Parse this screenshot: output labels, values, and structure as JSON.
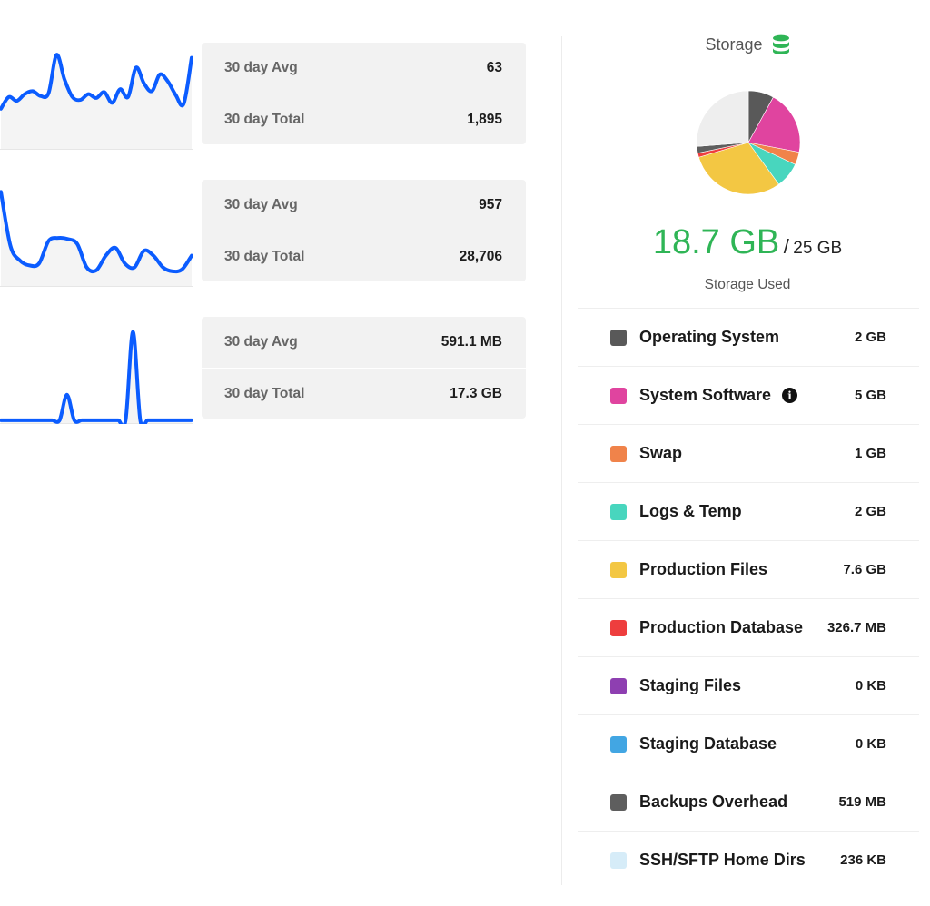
{
  "metrics": [
    {
      "sparkline": [
        40,
        52,
        48,
        55,
        58,
        53,
        56,
        95,
        70,
        52,
        49,
        55,
        51,
        57,
        46,
        60,
        52,
        82,
        66,
        58,
        75,
        68,
        54,
        45,
        92
      ],
      "avg_label": "30 day Avg",
      "avg_value": "63",
      "total_label": "30 day Total",
      "total_value": "1,895"
    },
    {
      "sparkline": [
        95,
        40,
        25,
        20,
        22,
        45,
        48,
        47,
        42,
        18,
        15,
        30,
        38,
        22,
        18,
        35,
        30,
        18,
        14,
        16,
        30
      ],
      "avg_label": "30 day Avg",
      "avg_value": "957",
      "total_label": "30 day Total",
      "total_value": "28,706"
    },
    {
      "sparkline": [
        2,
        2,
        2,
        2,
        2,
        2,
        2,
        2,
        2,
        28,
        2,
        2,
        2,
        2,
        2,
        2,
        2,
        2,
        92,
        2,
        2,
        2,
        2,
        2,
        2,
        2,
        2
      ],
      "avg_label": "30 day Avg",
      "avg_value": "591.1 MB",
      "total_label": "30 day Total",
      "total_value": "17.3 GB"
    }
  ],
  "storage": {
    "title": "Storage",
    "icon": "database-icon",
    "used_value": "18.7 GB",
    "separator": "/",
    "total": "25 GB",
    "used_label": "Storage Used",
    "accent": "#2fb556",
    "pie_free_color": "#eeeeee",
    "items": [
      {
        "name": "Operating System",
        "size": "2 GB",
        "gb": 2,
        "color": "#595959",
        "info": false
      },
      {
        "name": "System Software",
        "size": "5 GB",
        "gb": 5,
        "color": "#e0449f",
        "info": true
      },
      {
        "name": "Swap",
        "size": "1 GB",
        "gb": 1,
        "color": "#f0834a",
        "info": false
      },
      {
        "name": "Logs & Temp",
        "size": "2 GB",
        "gb": 2,
        "color": "#48d6be",
        "info": false
      },
      {
        "name": "Production Files",
        "size": "7.6 GB",
        "gb": 7.6,
        "color": "#f3c743",
        "info": false
      },
      {
        "name": "Production Database",
        "size": "326.7 MB",
        "gb": 0.3267,
        "color": "#ee3e3e",
        "info": false
      },
      {
        "name": "Staging Files",
        "size": "0 KB",
        "gb": 0,
        "color": "#8e3fb1",
        "info": false
      },
      {
        "name": "Staging Database",
        "size": "0 KB",
        "gb": 0,
        "color": "#42a6e3",
        "info": false
      },
      {
        "name": "Backups Overhead",
        "size": "519 MB",
        "gb": 0.519,
        "color": "#5e5e5e",
        "info": false
      },
      {
        "name": "SSH/SFTP Home Dirs",
        "size": "236 KB",
        "gb": 0.000236,
        "color": "#d6ecf8",
        "info": false
      }
    ]
  }
}
